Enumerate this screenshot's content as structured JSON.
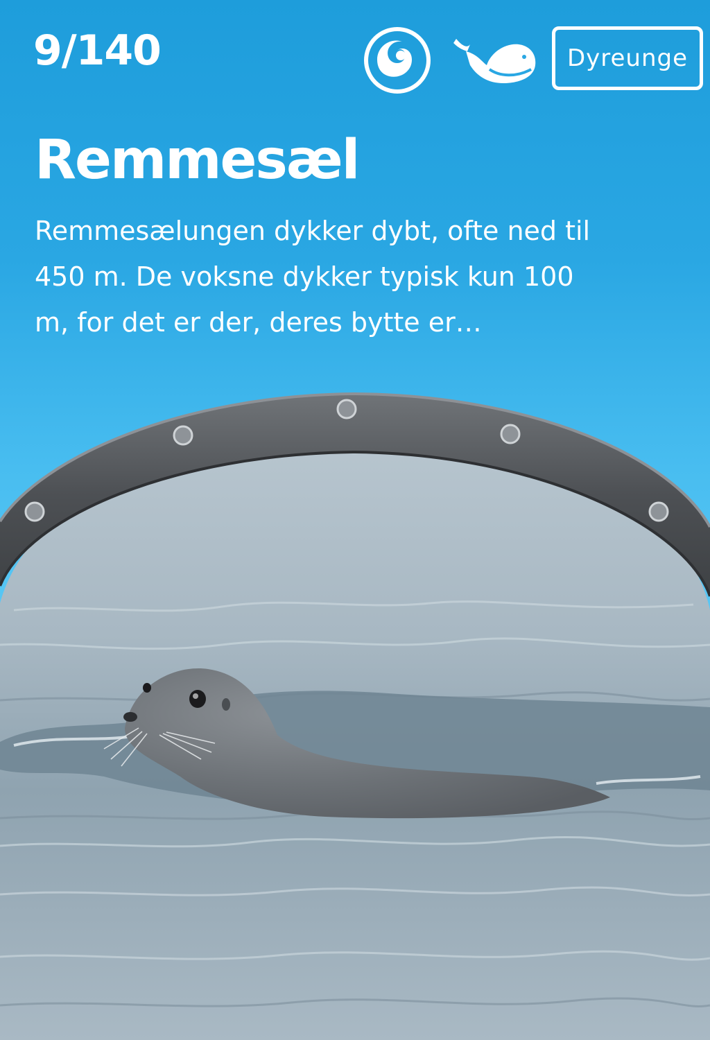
{
  "header": {
    "counter": "9/140",
    "icons": [
      "ocean-wave-icon",
      "whale-icon"
    ],
    "category_button": "Dyreunge"
  },
  "animal": {
    "name": "Remmesæl",
    "description": "Remmesælungen dykker dybt, ofte ned til 450 m. De voksne dykker typisk kun 100 m, for det er der, deres bytte er…"
  },
  "colors": {
    "background_top": "#1e9ddb",
    "background_bottom": "#5ac8f5",
    "text": "#ffffff",
    "porthole_frame": "#5a5d60",
    "water": "#9fb0bc"
  }
}
